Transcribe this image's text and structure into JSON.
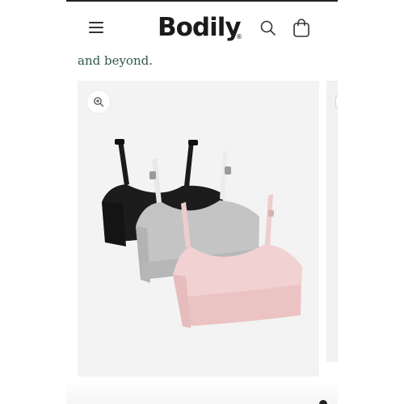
{
  "header": {
    "logo_text": "Bodily",
    "logo_mark": "®",
    "icons": {
      "menu": "hamburger-menu-icon",
      "search": "search-icon",
      "cart": "shopping-bag-icon"
    }
  },
  "hero": {
    "tagline": "and beyond."
  },
  "product_card": {
    "zoom_icon": "zoom-in-icon",
    "image_description_colors": {
      "bra_1": "#1a1a1a",
      "bra_2": "#bfbfbf",
      "bra_3": "#f2d3d3"
    }
  },
  "colors": {
    "tagline": "#2f5845",
    "card_background": "#f3f3f3"
  }
}
